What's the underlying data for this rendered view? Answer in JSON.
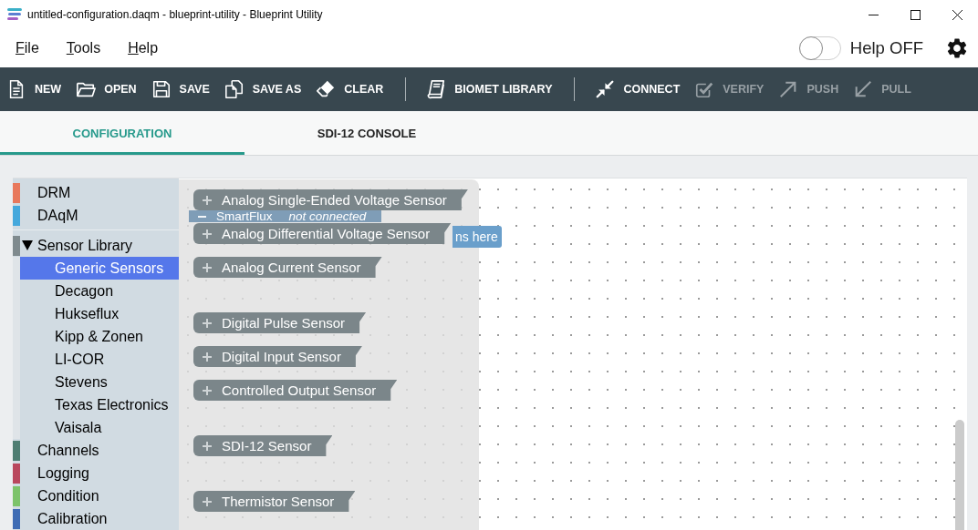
{
  "window": {
    "title": "untitled-configuration.daqm - blueprint-utility - Blueprint Utility"
  },
  "menu": [
    {
      "label": "File"
    },
    {
      "label": "Tools"
    },
    {
      "label": "Help"
    }
  ],
  "help_toggle": {
    "label": "Help OFF",
    "on": false
  },
  "toolbar": [
    [
      {
        "label": "NEW",
        "disabled": false
      },
      {
        "label": "OPEN",
        "disabled": false
      },
      {
        "label": "SAVE",
        "disabled": false
      },
      {
        "label": "SAVE AS",
        "disabled": false
      },
      {
        "label": "CLEAR",
        "disabled": false
      }
    ],
    [
      {
        "label": "BIOMET LIBRARY",
        "disabled": false
      }
    ],
    [
      {
        "label": "CONNECT",
        "disabled": false
      },
      {
        "label": "VERIFY",
        "disabled": true
      },
      {
        "label": "PUSH",
        "disabled": true
      },
      {
        "label": "PULL",
        "disabled": true
      }
    ]
  ],
  "tabs": [
    {
      "label": "CONFIGURATION",
      "selected": true
    },
    {
      "label": "SDI-12 CONSOLE",
      "selected": false
    }
  ],
  "toolbox": {
    "sections": [
      [
        {
          "label": "DRM",
          "color": "#e8785c",
          "selected": false
        },
        {
          "label": "DAqM",
          "color": "#45a8dc",
          "selected": false
        }
      ],
      [
        {
          "label": "Sensor Library",
          "color": "#7f8a8e",
          "selected": false,
          "expanded": true,
          "children": [
            {
              "label": "Generic Sensors",
              "selected": true
            },
            {
              "label": "Decagon",
              "selected": false
            },
            {
              "label": "Hukseflux",
              "selected": false
            },
            {
              "label": "Kipp & Zonen",
              "selected": false
            },
            {
              "label": "LI-COR",
              "selected": false
            },
            {
              "label": "Stevens",
              "selected": false
            },
            {
              "label": "Texas Electronics",
              "selected": false
            },
            {
              "label": "Vaisala",
              "selected": false
            }
          ]
        },
        {
          "label": "Channels",
          "color": "#4e7d72",
          "selected": false
        },
        {
          "label": "Logging",
          "color": "#b9475d",
          "selected": false
        },
        {
          "label": "Condition",
          "color": "#7cc36a",
          "selected": false
        },
        {
          "label": "Calibration",
          "color": "#3f6cb4",
          "selected": false
        }
      ]
    ]
  },
  "workspace": {
    "smartflux_block": {
      "title": "SmartFlux",
      "status": "not connected",
      "slot": "ns here"
    }
  },
  "flyout": {
    "groups": [
      [
        "Analog Single-Ended Voltage Sensor",
        "Analog Differential Voltage Sensor",
        "Analog Current Sensor"
      ],
      [
        "Digital Pulse Sensor",
        "Digital Input Sensor",
        "Controlled Output Sensor"
      ],
      [
        "SDI-12 Sensor"
      ],
      [
        "Thermistor Sensor"
      ]
    ]
  }
}
